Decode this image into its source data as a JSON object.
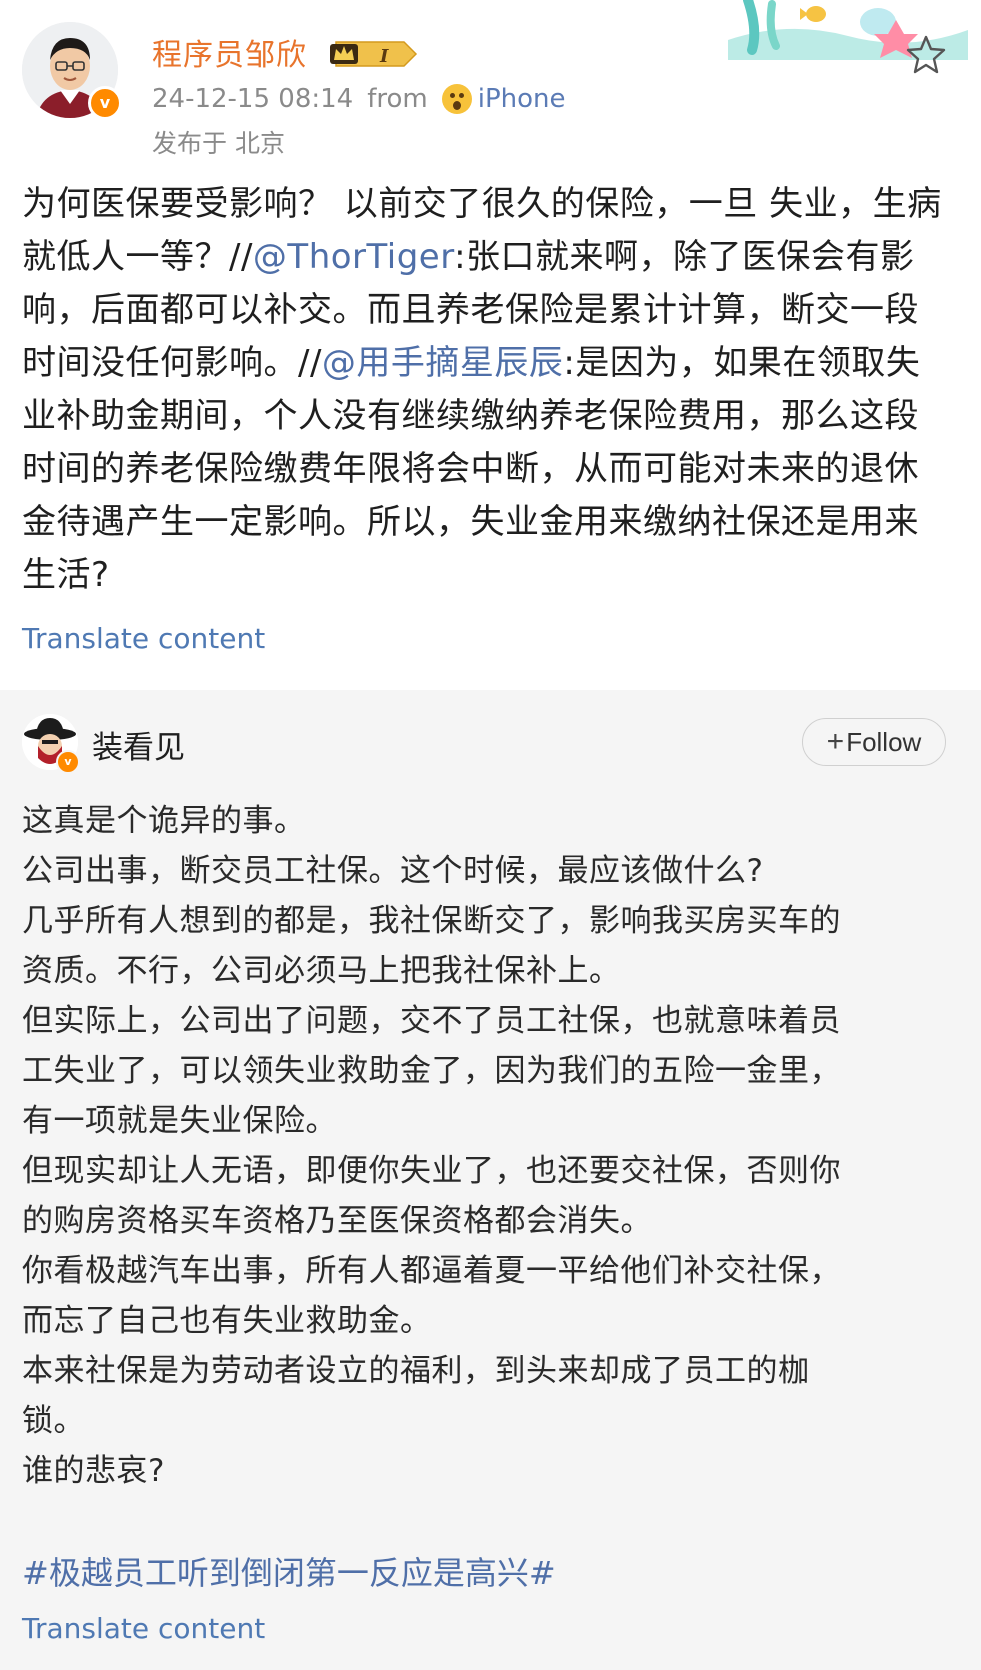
{
  "post": {
    "author": "程序员邹欣",
    "vip_level": "I",
    "timestamp": "24-12-15 08:14",
    "from_label": "from",
    "source": "iPhone",
    "location": "发布于 北京",
    "content_segments": [
      {
        "text": "为何医保要受影响？ 以前交了很久的保险，一旦 失业，生病就低人一等？//",
        "type": "text"
      },
      {
        "text": "@ThorTiger",
        "type": "mention"
      },
      {
        "text": ":张口就来啊，除了医保会有影响，后面都可以补交。而且养老保险是累计计算，断交一段时间没任何影响。//",
        "type": "text"
      },
      {
        "text": "@用手摘星辰辰",
        "type": "mention"
      },
      {
        "text": ":是因为，如果在领取失业补助金期间，个人没有继续缴纳养老保险费用，那么这段时间的养老保险缴费年限将会中断，从而可能对未来的退休金待遇产生一定影响。所以，失业金用来缴纳社保还是用来生活?",
        "type": "text"
      }
    ],
    "translate_label": "Translate content"
  },
  "repost": {
    "author": "装看见",
    "follow_label": "Follow",
    "lines": [
      "这真是个诡异的事。",
      "公司出事，断交员工社保。这个时候，最应该做什么?",
      "几乎所有人想到的都是，我社保断交了，影响我买房买车的",
      "资质。不行，公司必须马上把我社保补上。",
      "但实际上，公司出了问题，交不了员工社保，也就意味着员",
      "工失业了，可以领失业救助金了，因为我们的五险一金里，",
      "有一项就是失业保险。",
      "但现实却让人无语，即便你失业了，也还要交社保，否则你",
      "的购房资格买车资格乃至医保资格都会消失。",
      "你看极越汽车出事，所有人都逼着夏一平给他们补交社保，",
      "而忘了自己也有失业救助金。",
      "本来社保是为劳动者设立的福利，到头来却成了员工的枷",
      "锁。",
      "谁的悲哀?"
    ],
    "hashtag": "#极越员工听到倒闭第一反应是高兴#",
    "translate_label": "Translate content"
  },
  "colors": {
    "username": "#e8742c",
    "mention": "#4f6fa8",
    "translate": "#4f79b3",
    "verified": "#ff8a00",
    "repost_bg": "#f5f5f5"
  },
  "icons": [
    "verified-badge-icon",
    "vip-badge-icon",
    "surprised-emoji-icon",
    "star-favorite-icon",
    "follow-plus-icon"
  ]
}
